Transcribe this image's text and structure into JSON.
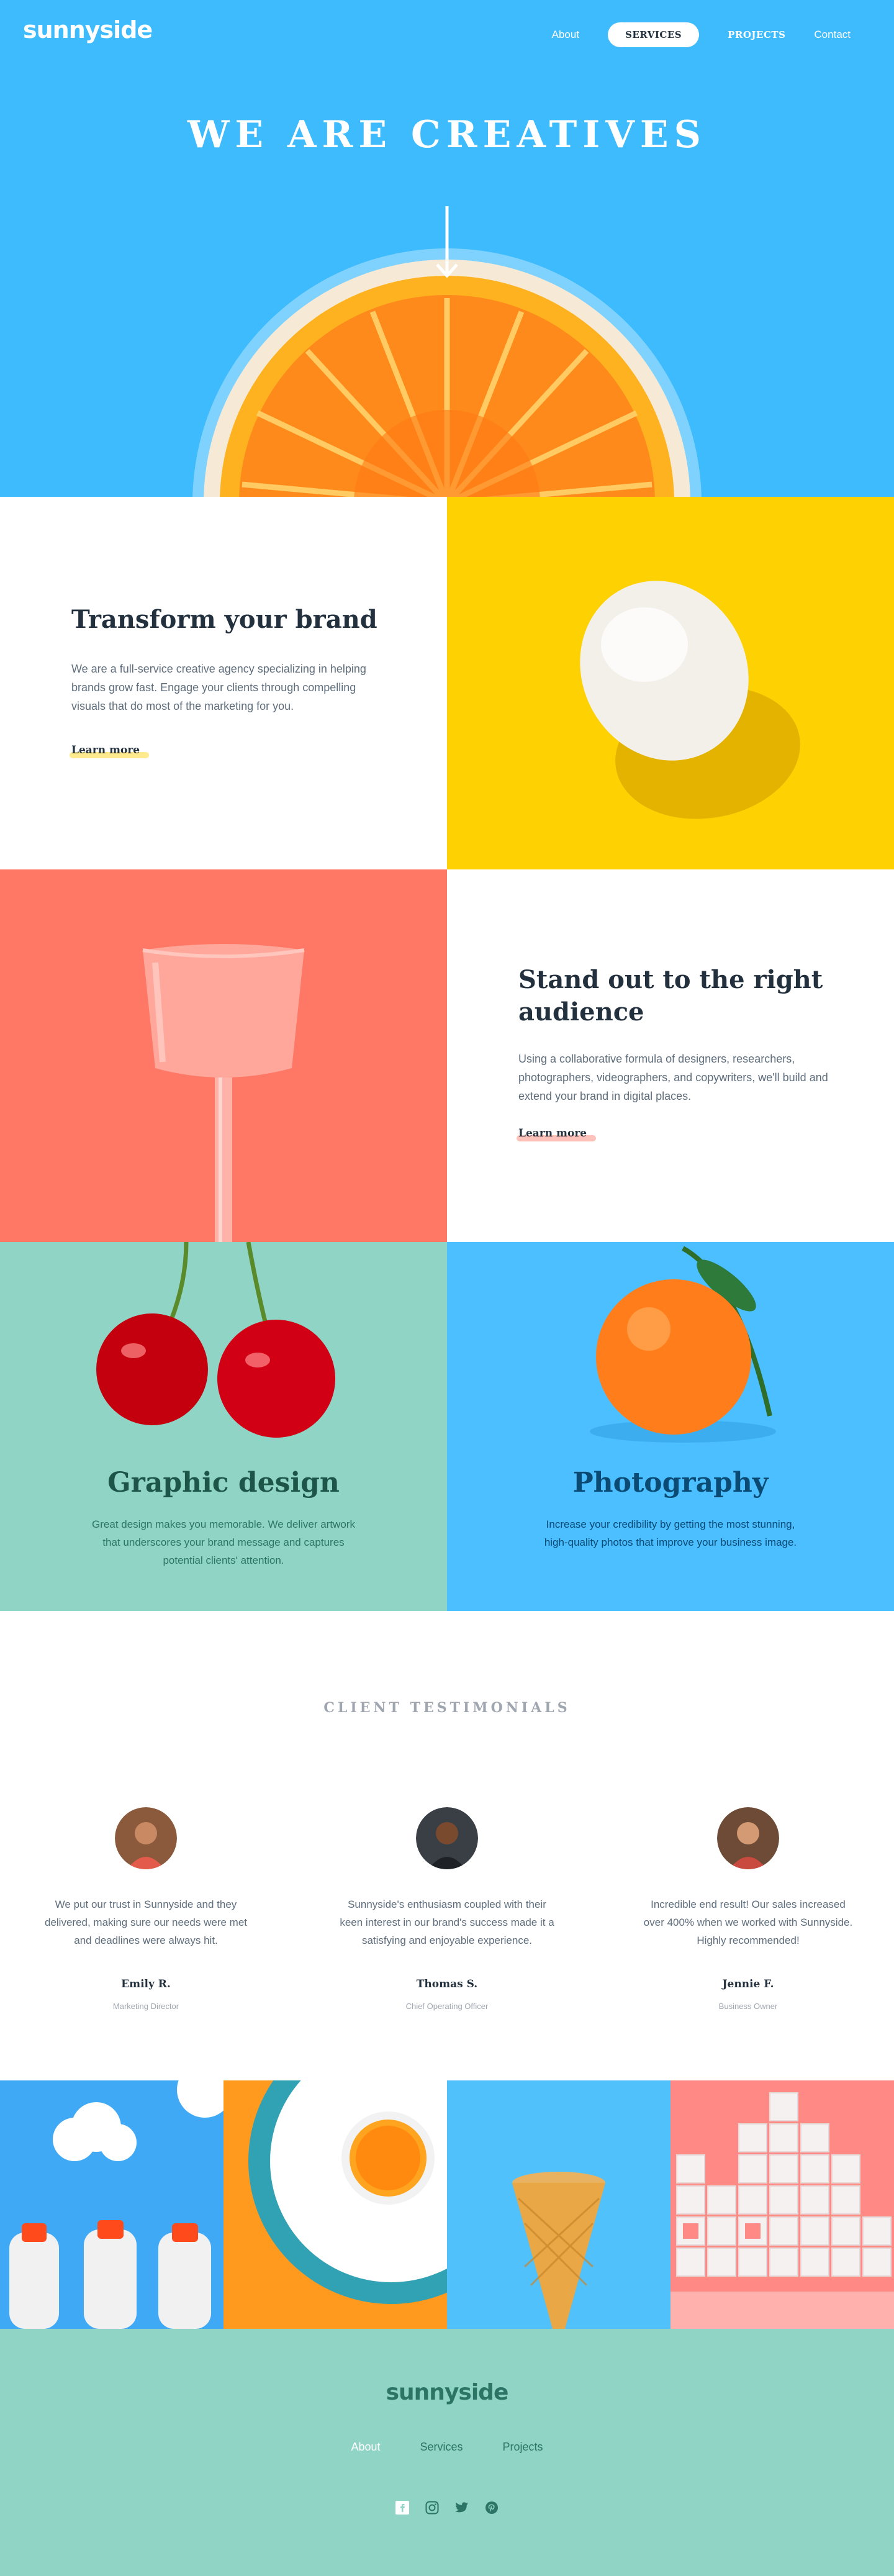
{
  "header": {
    "logo": "sunnyside",
    "nav": {
      "about": "About",
      "services": "SERVICES",
      "projects": "PROJECTS",
      "contact": "Contact"
    }
  },
  "hero": {
    "title": "WE ARE CREATIVES"
  },
  "features": {
    "brand": {
      "title": "Transform your brand",
      "text": "We are a full-service creative agency specializing in helping brands grow fast. Engage your clients through compelling visuals that do most of the marketing for you.",
      "link": "Learn more"
    },
    "audience": {
      "title": "Stand out to the right audience",
      "text": "Using a collaborative formula of designers, researchers, photographers, videographers, and copywriters, we'll build and extend your brand in digital places.",
      "link": "Learn more"
    },
    "graphic_design": {
      "title": "Graphic design",
      "text": "Great design makes you memorable. We deliver artwork that underscores your brand message and captures potential clients' attention."
    },
    "photography": {
      "title": "Photography",
      "text": "Increase your credibility by getting the most stunning, high-quality photos that improve your business image."
    }
  },
  "testimonials": {
    "heading": "CLIENT TESTIMONIALS",
    "items": [
      {
        "text": "We put our trust in Sunnyside and they delivered, making sure our needs were met and deadlines were always hit.",
        "name": "Emily R.",
        "role": "Marketing Director",
        "avatar_icon": "woman-avatar-icon"
      },
      {
        "text": "Sunnyside's enthusiasm coupled with their keen interest in our brand's success made it a satisfying and enjoyable experience.",
        "name": "Thomas S.",
        "role": "Chief Operating Officer",
        "avatar_icon": "man-avatar-icon"
      },
      {
        "text": "Incredible end result! Our sales increased over 400% when we worked with Sunnyside. Highly recommended!",
        "name": "Jennie F.",
        "role": "Business Owner",
        "avatar_icon": "woman-avatar-icon"
      }
    ]
  },
  "footer": {
    "logo": "sunnyside",
    "nav": {
      "about": "About",
      "services": "Services",
      "projects": "Projects"
    },
    "socials": [
      "facebook-icon",
      "instagram-icon",
      "twitter-icon",
      "pinterest-icon"
    ]
  },
  "colors": {
    "hero_blue": "#3dbbfd",
    "yellow": "#fed102",
    "coral": "#fe7865",
    "mint": "#90d4c5",
    "dark_navy": "#23303e",
    "dark_teal": "#2c7566",
    "photo_blue": "#4bbfff"
  }
}
